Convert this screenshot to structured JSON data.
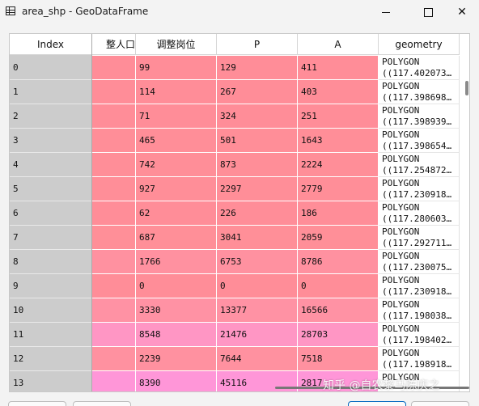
{
  "window": {
    "title": "area_shp - GeoDataFrame",
    "icon": "table-icon",
    "controls": [
      "minimize-icon",
      "maximize-icon",
      "close-icon"
    ]
  },
  "table": {
    "index_header": "Index",
    "headers": [
      "整人口",
      "调整岗位",
      "P",
      "A",
      "geometry"
    ],
    "rows": [
      {
        "index": "0",
        "c1": "99",
        "p": "129",
        "a": "411",
        "geom1": "POLYGON",
        "geom2": "((117.402073…",
        "color": "#ff8d98"
      },
      {
        "index": "1",
        "c1": "114",
        "p": "267",
        "a": "403",
        "geom1": "POLYGON",
        "geom2": "((117.398698…",
        "color": "#ff8d98"
      },
      {
        "index": "2",
        "c1": "71",
        "p": "324",
        "a": "251",
        "geom1": "POLYGON",
        "geom2": "((117.398939…",
        "color": "#ff8d98"
      },
      {
        "index": "3",
        "c1": "465",
        "p": "501",
        "a": "1643",
        "geom1": "POLYGON",
        "geom2": "((117.398654…",
        "color": "#ff8e98"
      },
      {
        "index": "4",
        "c1": "742",
        "p": "873",
        "a": "2224",
        "geom1": "POLYGON",
        "geom2": "((117.254872…",
        "color": "#ff8e98"
      },
      {
        "index": "5",
        "c1": "927",
        "p": "2297",
        "a": "2779",
        "geom1": "POLYGON",
        "geom2": "((117.230918…",
        "color": "#ff8e98"
      },
      {
        "index": "6",
        "c1": "62",
        "p": "226",
        "a": "186",
        "geom1": "POLYGON",
        "geom2": "((117.280603…",
        "color": "#ff8d98"
      },
      {
        "index": "7",
        "c1": "687",
        "p": "3041",
        "a": "2059",
        "geom1": "POLYGON",
        "geom2": "((117.292711…",
        "color": "#ff8f98"
      },
      {
        "index": "8",
        "c1": "1766",
        "p": "6753",
        "a": "8786",
        "geom1": "POLYGON",
        "geom2": "((117.230075…",
        "color": "#ff91a0"
      },
      {
        "index": "9",
        "c1": "0",
        "p": "0",
        "a": "0",
        "geom1": "POLYGON",
        "geom2": "((117.230918…",
        "color": "#ff8d98"
      },
      {
        "index": "10",
        "c1": "3330",
        "p": "13377",
        "a": "16566",
        "geom1": "POLYGON",
        "geom2": "((117.198038…",
        "color": "#ff92a4"
      },
      {
        "index": "11",
        "c1": "8548",
        "p": "21476",
        "a": "28703",
        "geom1": "POLYGON",
        "geom2": "((117.198402…",
        "color": "#ff96c4"
      },
      {
        "index": "12",
        "c1": "2239",
        "p": "7644",
        "a": "7518",
        "geom1": "POLYGON",
        "geom2": "((117.198918…",
        "color": "#ff91a0"
      },
      {
        "index": "13",
        "c1": "8390",
        "p": "45116",
        "a": "2817",
        "geom1": "POLYGON",
        "geom2": "",
        "color": "#ff96d8"
      }
    ]
  },
  "watermark": "知乎 @自农黎马陈庆之"
}
